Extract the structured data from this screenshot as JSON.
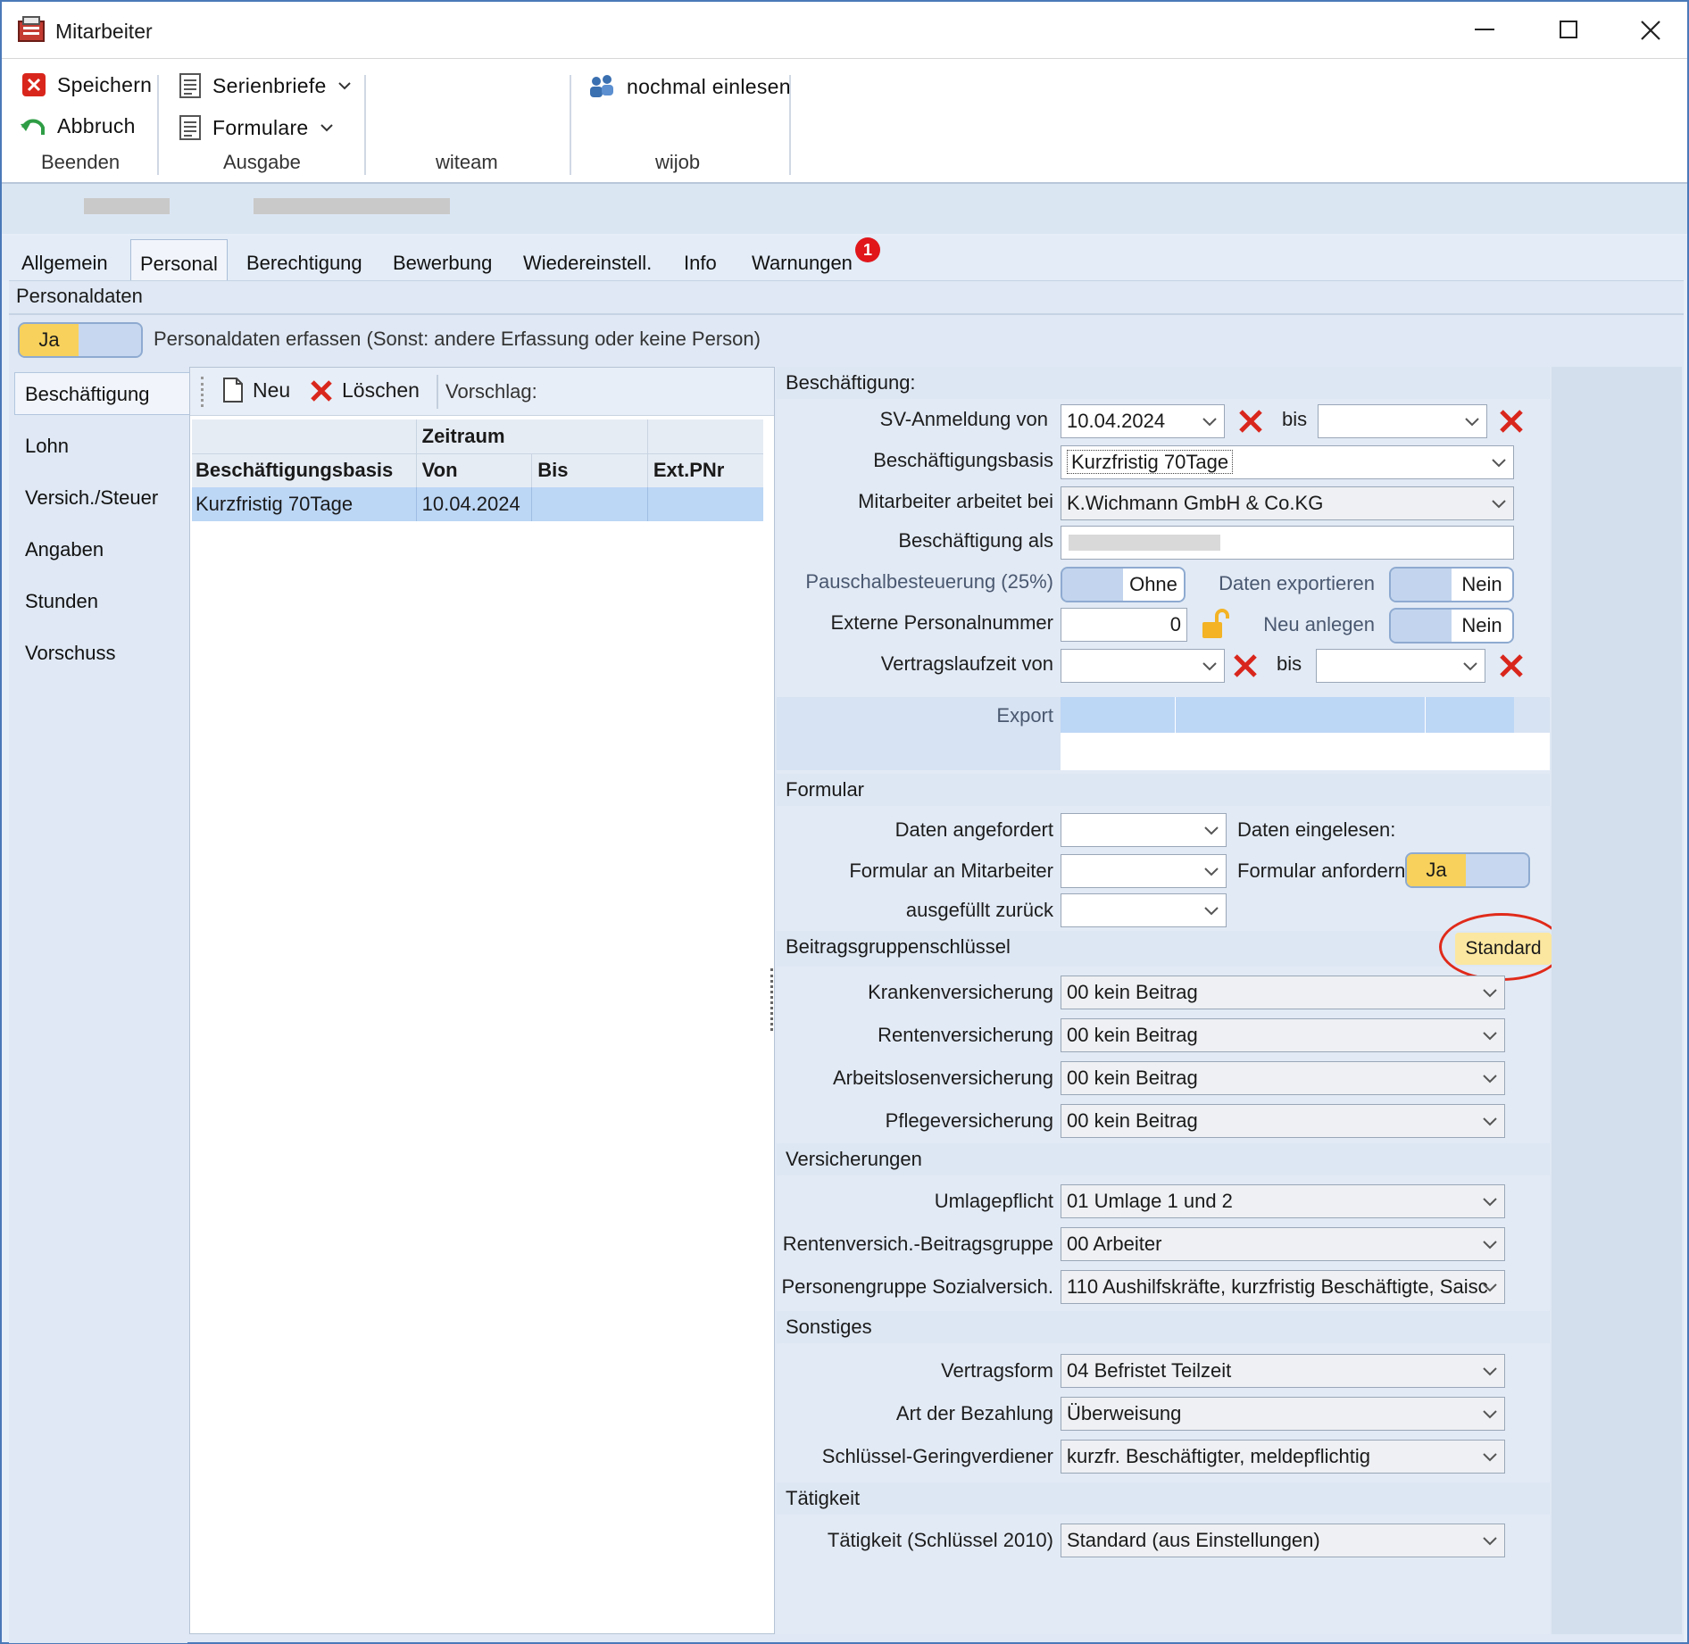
{
  "window": {
    "title": "Mitarbeiter"
  },
  "ribbon": {
    "speichern": "Speichern",
    "abbruch": "Abbruch",
    "beenden": "Beenden",
    "serienbriefe": "Serienbriefe",
    "formulare": "Formulare",
    "ausgabe": "Ausgabe",
    "witeam": "witeam",
    "nochmal_einlesen": "nochmal einlesen",
    "wijob": "wijob"
  },
  "tabs": [
    "Allgemein",
    "Personal",
    "Berechtigung",
    "Bewerbung",
    "Wiedereinstell.",
    "Info",
    "Warnungen"
  ],
  "warnungen_badge": "1",
  "personaldaten": {
    "header": "Personaldaten",
    "toggle_on": "Ja",
    "caption": "Personaldaten erfassen (Sonst: andere Erfassung oder keine Person)"
  },
  "sidebar": [
    "Beschäftigung",
    "Lohn",
    "Versich./Steuer",
    "Angaben",
    "Stunden",
    "Vorschuss"
  ],
  "list_toolbar": {
    "neu": "Neu",
    "loeschen": "Löschen",
    "vorschlag": "Vorschlag:"
  },
  "grid": {
    "group_header": "Zeitraum",
    "columns": [
      "Beschäftigungsbasis",
      "Von",
      "Bis",
      "Ext.PNr"
    ],
    "rows": [
      [
        "Kurzfristig 70Tage",
        "10.04.2024",
        "",
        ""
      ]
    ]
  },
  "beschaeftigung": {
    "header": "Beschäftigung:",
    "sv_label": "SV-Anmeldung von",
    "sv_von": "10.04.2024",
    "bis": "bis",
    "sv_bis": "",
    "basis_label": "Beschäftigungsbasis",
    "basis": "Kurzfristig 70Tage",
    "arbeitet_label": "Mitarbeiter arbeitet bei",
    "arbeitet": "K.Wichmann GmbH & Co.KG",
    "als_label": "Beschäftigung als",
    "pausch_label": "Pauschalbesteuerung (25%)",
    "pausch_value": "Ohne",
    "export_label": "Daten exportieren",
    "export_value": "Nein",
    "ext_label": "Externe Personalnummer",
    "ext_value": "0",
    "neu_label": "Neu anlegen",
    "neu_value": "Nein",
    "vertrag_label": "Vertragslaufzeit von",
    "export_row_label": "Export"
  },
  "formular": {
    "header": "Formular",
    "angefordert": "Daten angefordert",
    "eingelesen": "Daten eingelesen:",
    "an_mitarbeiter": "Formular an Mitarbeiter",
    "anfordern": "Formular anfordern:",
    "anfordern_value": "Ja",
    "zurueck": "ausgefüllt zurück"
  },
  "bgs": {
    "header": "Beitragsgruppenschlüssel",
    "standard_button": "Standard",
    "rows": [
      {
        "label": "Krankenversicherung",
        "value": "00 kein Beitrag"
      },
      {
        "label": "Rentenversicherung",
        "value": "00 kein Beitrag"
      },
      {
        "label": "Arbeitslosenversicherung",
        "value": "00 kein Beitrag"
      },
      {
        "label": "Pflegeversicherung",
        "value": "00 kein Beitrag"
      }
    ]
  },
  "versicherungen": {
    "header": "Versicherungen",
    "rows": [
      {
        "label": "Umlagepflicht",
        "value": "01 Umlage 1 und 2"
      },
      {
        "label": "Rentenversich.-Beitragsgruppe",
        "value": "00 Arbeiter"
      },
      {
        "label": "Personengruppe Sozialversich.",
        "value": "110 Aushilfskräfte, kurzfristig Beschäftigte, Saisc"
      }
    ]
  },
  "sonstiges": {
    "header": "Sonstiges",
    "rows": [
      {
        "label": "Vertragsform",
        "value": "04 Befristet Teilzeit"
      },
      {
        "label": "Art der Bezahlung",
        "value": "Überweisung"
      },
      {
        "label": "Schlüssel-Geringverdiener",
        "value": "kurzfr. Beschäftigter, meldepflichtig"
      }
    ]
  },
  "taetigkeit": {
    "header": "Tätigkeit",
    "label": "Tätigkeit (Schlüssel 2010)",
    "value": "Standard (aus Einstellungen)"
  },
  "colors": {
    "accent": "#f7d15c",
    "toggle_off": "#c6d7ef",
    "delete_red": "#d9261c",
    "highlight_ellipse": "#e02a1a",
    "selected_row": "#bcd6f5"
  }
}
